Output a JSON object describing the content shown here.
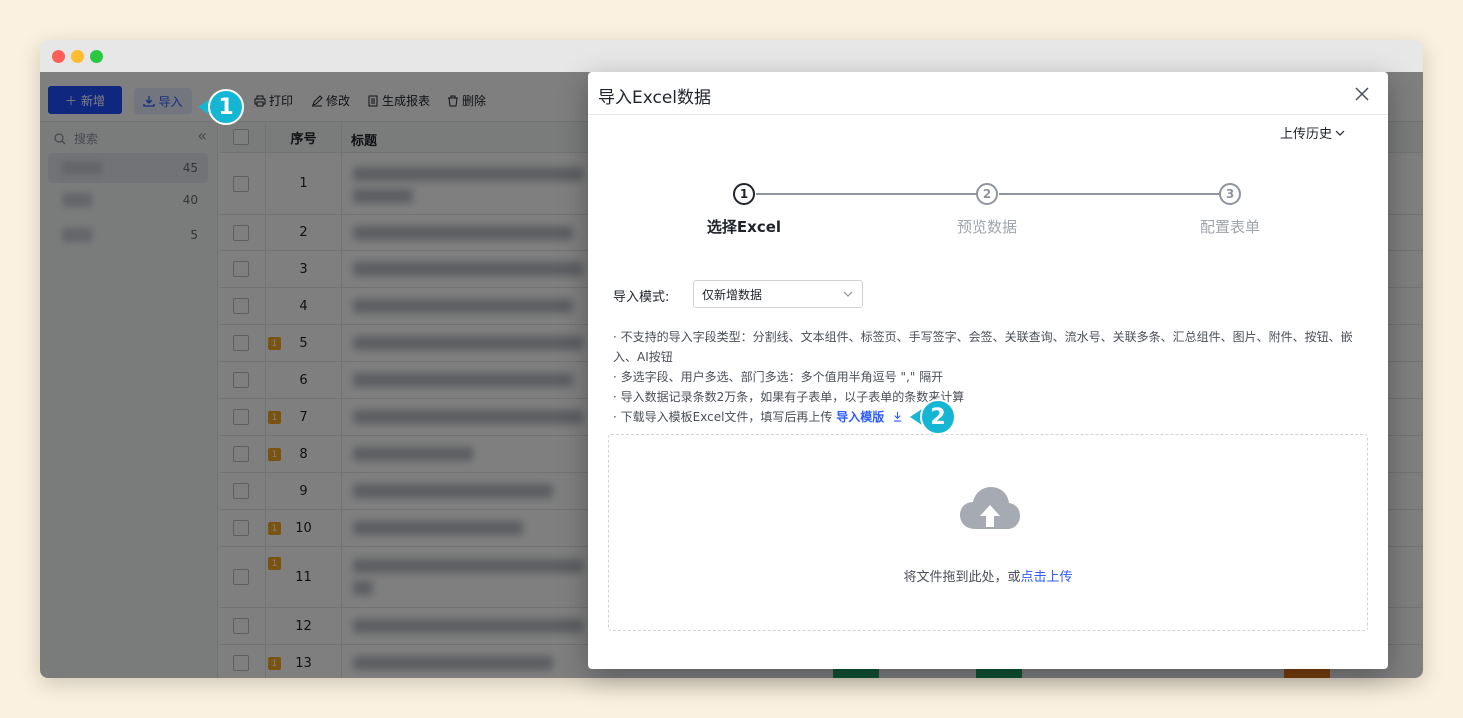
{
  "toolbar": {
    "new_label": "新增",
    "import_label": "导入",
    "print_label": "打印",
    "edit_label": "修改",
    "report_label": "生成报表",
    "delete_label": "删除"
  },
  "sidebar": {
    "search_placeholder": "搜索",
    "groups": [
      {
        "count": "45"
      },
      {
        "count": "40"
      },
      {
        "count": "5"
      }
    ]
  },
  "table": {
    "headers": {
      "seq": "序号",
      "title": "标题"
    },
    "rows": [
      {
        "seq": "1",
        "badge": ""
      },
      {
        "seq": "2",
        "badge": ""
      },
      {
        "seq": "3",
        "badge": ""
      },
      {
        "seq": "4",
        "badge": ""
      },
      {
        "seq": "5",
        "badge": "1"
      },
      {
        "seq": "6",
        "badge": ""
      },
      {
        "seq": "7",
        "badge": "1"
      },
      {
        "seq": "8",
        "badge": "1"
      },
      {
        "seq": "9",
        "badge": ""
      },
      {
        "seq": "10",
        "badge": "1"
      },
      {
        "seq": "11",
        "badge": "1"
      },
      {
        "seq": "12",
        "badge": ""
      },
      {
        "seq": "13",
        "badge": "1"
      }
    ]
  },
  "modal": {
    "title": "导入Excel数据",
    "upload_history": "上传历史",
    "steps": [
      {
        "number": "1",
        "label": "选择Excel",
        "state": "active"
      },
      {
        "number": "2",
        "label": "预览数据",
        "state": "pending"
      },
      {
        "number": "3",
        "label": "配置表单",
        "state": "pending"
      }
    ],
    "mode_label": "导入模式:",
    "mode_value": "仅新增数据",
    "notes": [
      "· 不支持的导入字段类型：分割线、文本组件、标签页、手写签字、会签、关联查询、流水号、关联多条、汇总组件、图片、附件、按钮、嵌入、AI按钮",
      "· 多选字段、用户多选、部门多选：多个值用半角逗号 \",\" 隔开",
      "· 导入数据记录条数2万条，如果有子表单，以子表单的条数来计算"
    ],
    "template_note_prefix": "· 下载导入模板Excel文件，填写后再上传",
    "template_link": "导入模版",
    "dropzone_text": "将文件拖到此处，或",
    "dropzone_link": "点击上传"
  },
  "callouts": {
    "first": "1",
    "second": "2"
  },
  "colors": {
    "primary": "#1f4fff",
    "link": "#2e5cff",
    "callout": "#14b6d3",
    "badge": "#f5a623",
    "background": "#fbf1e0"
  }
}
